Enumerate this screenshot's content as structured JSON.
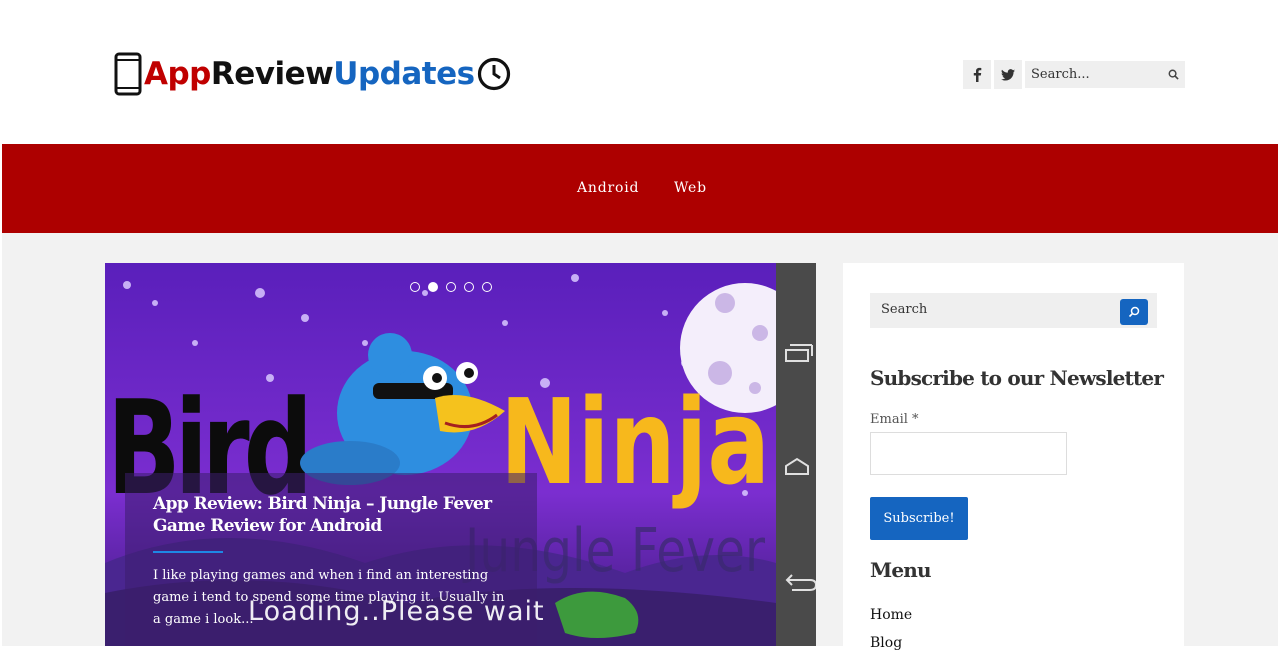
{
  "header": {
    "logo": {
      "part1": "App",
      "part2": "Review",
      "part3": "Updates"
    },
    "social": [
      {
        "icon": "facebook-icon"
      },
      {
        "icon": "twitter-icon"
      }
    ],
    "search": {
      "placeholder": "Search..."
    }
  },
  "nav": {
    "items": [
      {
        "label": "Android"
      },
      {
        "label": "Web"
      }
    ]
  },
  "slider": {
    "dots_count": 5,
    "active_dot": 2,
    "slide": {
      "title": "App Review: Bird Ninja – Jungle Fever Game Review for Android",
      "excerpt": "I like playing games and when i find an interesting game i tend to spend some time playing it. Usually in a game i look...",
      "overlay_text": "Loading..Please wait",
      "art_text_1": "Bird",
      "art_text_2": "Ninja",
      "art_text_3": "Jungle Fever"
    }
  },
  "sidebar": {
    "search": {
      "placeholder": "Search"
    },
    "newsletter": {
      "heading": "Subscribe to our Newsletter",
      "email_label": "Email",
      "required_mark": "*",
      "button_label": "Subscribe!"
    },
    "menu": {
      "heading": "Menu",
      "items": [
        {
          "label": "Home"
        },
        {
          "label": "Blog"
        }
      ]
    }
  },
  "colors": {
    "brand_red": "#ad0000",
    "accent_blue": "#1565c0",
    "slide_purple": "#5b20b8"
  }
}
